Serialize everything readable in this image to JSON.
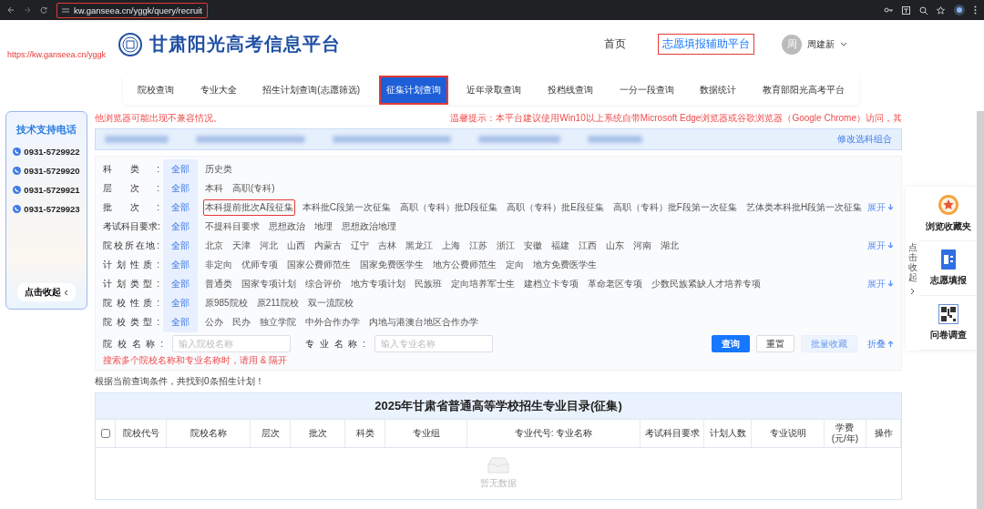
{
  "browser": {
    "url": "kw.ganseea.cn/yggk/query/recruit",
    "url_annotated": true
  },
  "annotation": {
    "link": "https://kw.ganseea.cn/yggk"
  },
  "header": {
    "site_title": "甘肃阳光高考信息平台",
    "links": [
      {
        "label": "首页",
        "annotated": false
      },
      {
        "label": "志愿填报辅助平台",
        "annotated": true
      }
    ],
    "user": {
      "avatar": "周",
      "name": "周建新"
    }
  },
  "nav_tabs": [
    {
      "label": "院校查询",
      "selected": false
    },
    {
      "label": "专业大全",
      "selected": false
    },
    {
      "label": "招生计划查询(志愿筛选)",
      "selected": false
    },
    {
      "label": "征集计划查询",
      "selected": true
    },
    {
      "label": "近年录取查询",
      "selected": false
    },
    {
      "label": "投档线查询",
      "selected": false
    },
    {
      "label": "一分一段查询",
      "selected": false
    },
    {
      "label": "数据统计",
      "selected": false
    },
    {
      "label": "教育部阳光高考平台",
      "selected": false
    }
  ],
  "support": {
    "title": "技术支持电话",
    "phones": [
      "0931-5729922",
      "0931-5729920",
      "0931-5729921",
      "0931-5729923"
    ],
    "collapse": "点击收起"
  },
  "notice": {
    "left": "他浏览器可能出现不兼容情况。",
    "right": "温馨提示：本平台建议使用Win10以上系统自带Microsoft Edge浏览器或谷歌浏览器（Google Chrome）访问，其"
  },
  "info_bar": {
    "action": "修改选科组合"
  },
  "filters": [
    {
      "label": "科类:",
      "options": [
        {
          "label": "全部",
          "selected": true,
          "annotated": false
        },
        {
          "label": "历史类",
          "selected": false,
          "annotated": false
        }
      ]
    },
    {
      "label": "层次:",
      "options": [
        {
          "label": "全部",
          "selected": true,
          "annotated": false
        },
        {
          "label": "本科",
          "selected": false,
          "annotated": false
        },
        {
          "label": "高职(专科)",
          "selected": false,
          "annotated": false
        }
      ]
    },
    {
      "label": "批次:",
      "options": [
        {
          "label": "全部",
          "selected": true,
          "annotated": false
        },
        {
          "label": "本科提前批次A段征集",
          "selected": false,
          "annotated": true
        },
        {
          "label": "本科批C段第一次征集",
          "selected": false,
          "annotated": false
        },
        {
          "label": "高职（专科）批D段征集",
          "selected": false,
          "annotated": false
        },
        {
          "label": "高职（专科）批E段征集",
          "selected": false,
          "annotated": false
        },
        {
          "label": "高职（专科）批F段第一次征集",
          "selected": false,
          "annotated": false
        },
        {
          "label": "艺体类本科批H段第一次征集",
          "selected": false,
          "annotated": false
        }
      ],
      "expand": "展开"
    },
    {
      "label": "考试科目要求:",
      "options": [
        {
          "label": "全部",
          "selected": true,
          "annotated": false
        },
        {
          "label": "不提科目要求",
          "selected": false,
          "annotated": false
        },
        {
          "label": "思想政治",
          "selected": false,
          "annotated": false
        },
        {
          "label": "地理",
          "selected": false,
          "annotated": false
        },
        {
          "label": "思想政治地理",
          "selected": false,
          "annotated": false
        }
      ]
    },
    {
      "label": "院校所在地:",
      "options": [
        {
          "label": "全部",
          "selected": true,
          "annotated": false
        },
        {
          "label": "北京",
          "selected": false,
          "annotated": false
        },
        {
          "label": "天津",
          "selected": false,
          "annotated": false
        },
        {
          "label": "河北",
          "selected": false,
          "annotated": false
        },
        {
          "label": "山西",
          "selected": false,
          "annotated": false
        },
        {
          "label": "内蒙古",
          "selected": false,
          "annotated": false
        },
        {
          "label": "辽宁",
          "selected": false,
          "annotated": false
        },
        {
          "label": "吉林",
          "selected": false,
          "annotated": false
        },
        {
          "label": "黑龙江",
          "selected": false,
          "annotated": false
        },
        {
          "label": "上海",
          "selected": false,
          "annotated": false
        },
        {
          "label": "江苏",
          "selected": false,
          "annotated": false
        },
        {
          "label": "浙江",
          "selected": false,
          "annotated": false
        },
        {
          "label": "安徽",
          "selected": false,
          "annotated": false
        },
        {
          "label": "福建",
          "selected": false,
          "annotated": false
        },
        {
          "label": "江西",
          "selected": false,
          "annotated": false
        },
        {
          "label": "山东",
          "selected": false,
          "annotated": false
        },
        {
          "label": "河南",
          "selected": false,
          "annotated": false
        },
        {
          "label": "湖北",
          "selected": false,
          "annotated": false
        }
      ],
      "expand": "展开"
    },
    {
      "label": "计划性质:",
      "options": [
        {
          "label": "全部",
          "selected": true,
          "annotated": false
        },
        {
          "label": "非定向",
          "selected": false,
          "annotated": false
        },
        {
          "label": "优师专项",
          "selected": false,
          "annotated": false
        },
        {
          "label": "国家公费师范生",
          "selected": false,
          "annotated": false
        },
        {
          "label": "国家免费医学生",
          "selected": false,
          "annotated": false
        },
        {
          "label": "地方公费师范生",
          "selected": false,
          "annotated": false
        },
        {
          "label": "定向",
          "selected": false,
          "annotated": false
        },
        {
          "label": "地方免费医学生",
          "selected": false,
          "annotated": false
        }
      ]
    },
    {
      "label": "计划类型:",
      "options": [
        {
          "label": "全部",
          "selected": true,
          "annotated": false
        },
        {
          "label": "普通类",
          "selected": false,
          "annotated": false
        },
        {
          "label": "国家专项计划",
          "selected": false,
          "annotated": false
        },
        {
          "label": "综合评价",
          "selected": false,
          "annotated": false
        },
        {
          "label": "地方专项计划",
          "selected": false,
          "annotated": false
        },
        {
          "label": "民族班",
          "selected": false,
          "annotated": false
        },
        {
          "label": "定向培养军士生",
          "selected": false,
          "annotated": false
        },
        {
          "label": "建档立卡专项",
          "selected": false,
          "annotated": false
        },
        {
          "label": "革命老区专项",
          "selected": false,
          "annotated": false
        },
        {
          "label": "少数民族紧缺人才培养专项",
          "selected": false,
          "annotated": false
        }
      ],
      "expand": "展开"
    },
    {
      "label": "院校性质:",
      "options": [
        {
          "label": "全部",
          "selected": true,
          "annotated": false
        },
        {
          "label": "原985院校",
          "selected": false,
          "annotated": false
        },
        {
          "label": "原211院校",
          "selected": false,
          "annotated": false
        },
        {
          "label": "双一流院校",
          "selected": false,
          "annotated": false
        }
      ]
    },
    {
      "label": "院校类型:",
      "options": [
        {
          "label": "全部",
          "selected": true,
          "annotated": false
        },
        {
          "label": "公办",
          "selected": false,
          "annotated": false
        },
        {
          "label": "民办",
          "selected": false,
          "annotated": false
        },
        {
          "label": "独立学院",
          "selected": false,
          "annotated": false
        },
        {
          "label": "中外合作办学",
          "selected": false,
          "annotated": false
        },
        {
          "label": "内地与港澳台地区合作办学",
          "selected": false,
          "annotated": false
        }
      ]
    }
  ],
  "search": {
    "fields": [
      {
        "label": "院校名称:",
        "placeholder": "输入院校名称"
      },
      {
        "label": "专业名称:",
        "placeholder": "输入专业名称"
      }
    ],
    "hint": "搜索多个院校名称和专业名称时，请用 & 隔开",
    "buttons": [
      {
        "label": "查询",
        "kind": "primary"
      },
      {
        "label": "重置",
        "kind": "default"
      },
      {
        "label": "批量收藏",
        "kind": "light"
      }
    ],
    "collapse": "折叠"
  },
  "result_text": "根据当前查询条件，共找到0条招生计划！",
  "table": {
    "title": "2025年甘肃省普通高等学校招生专业目录(征集)",
    "select_all": {
      "checked": false
    },
    "columns": [
      "院校代号",
      "院校名称",
      "层次",
      "批次",
      "科类",
      "专业组",
      "专业代号: 专业名称",
      "考试科目要求",
      "计划人数",
      "专业说明",
      "学费\n(元/年)",
      "操作"
    ],
    "empty": "暂无数据"
  },
  "side_panel": {
    "toggle": "点击收起",
    "items": [
      {
        "label": "浏览收藏夹",
        "kind": "favorites"
      },
      {
        "label": "志愿填报",
        "kind": "form"
      },
      {
        "label": "问卷调查",
        "kind": "qr"
      }
    ]
  }
}
